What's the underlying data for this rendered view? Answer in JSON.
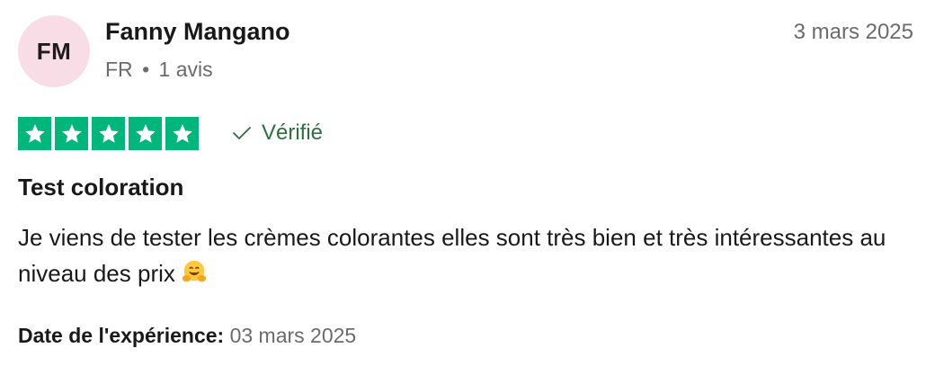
{
  "user": {
    "initials": "FM",
    "name": "Fanny Mangano",
    "country": "FR",
    "separator": "•",
    "review_count": "1 avis",
    "avatar_color": "#f8dde6"
  },
  "review": {
    "date": "3 mars 2025",
    "rating": 5,
    "rating_color": "#00b67a",
    "verified_label": "Vérifié",
    "verified_color": "#2f6f3e",
    "title": "Test coloration",
    "body": "Je viens de tester les crèmes colorantes elles sont très bien et très intéressantes au niveau des prix",
    "emoji": "hugging-face-icon",
    "experience_label": "Date de l'expérience:",
    "experience_date": "03 mars 2025"
  }
}
